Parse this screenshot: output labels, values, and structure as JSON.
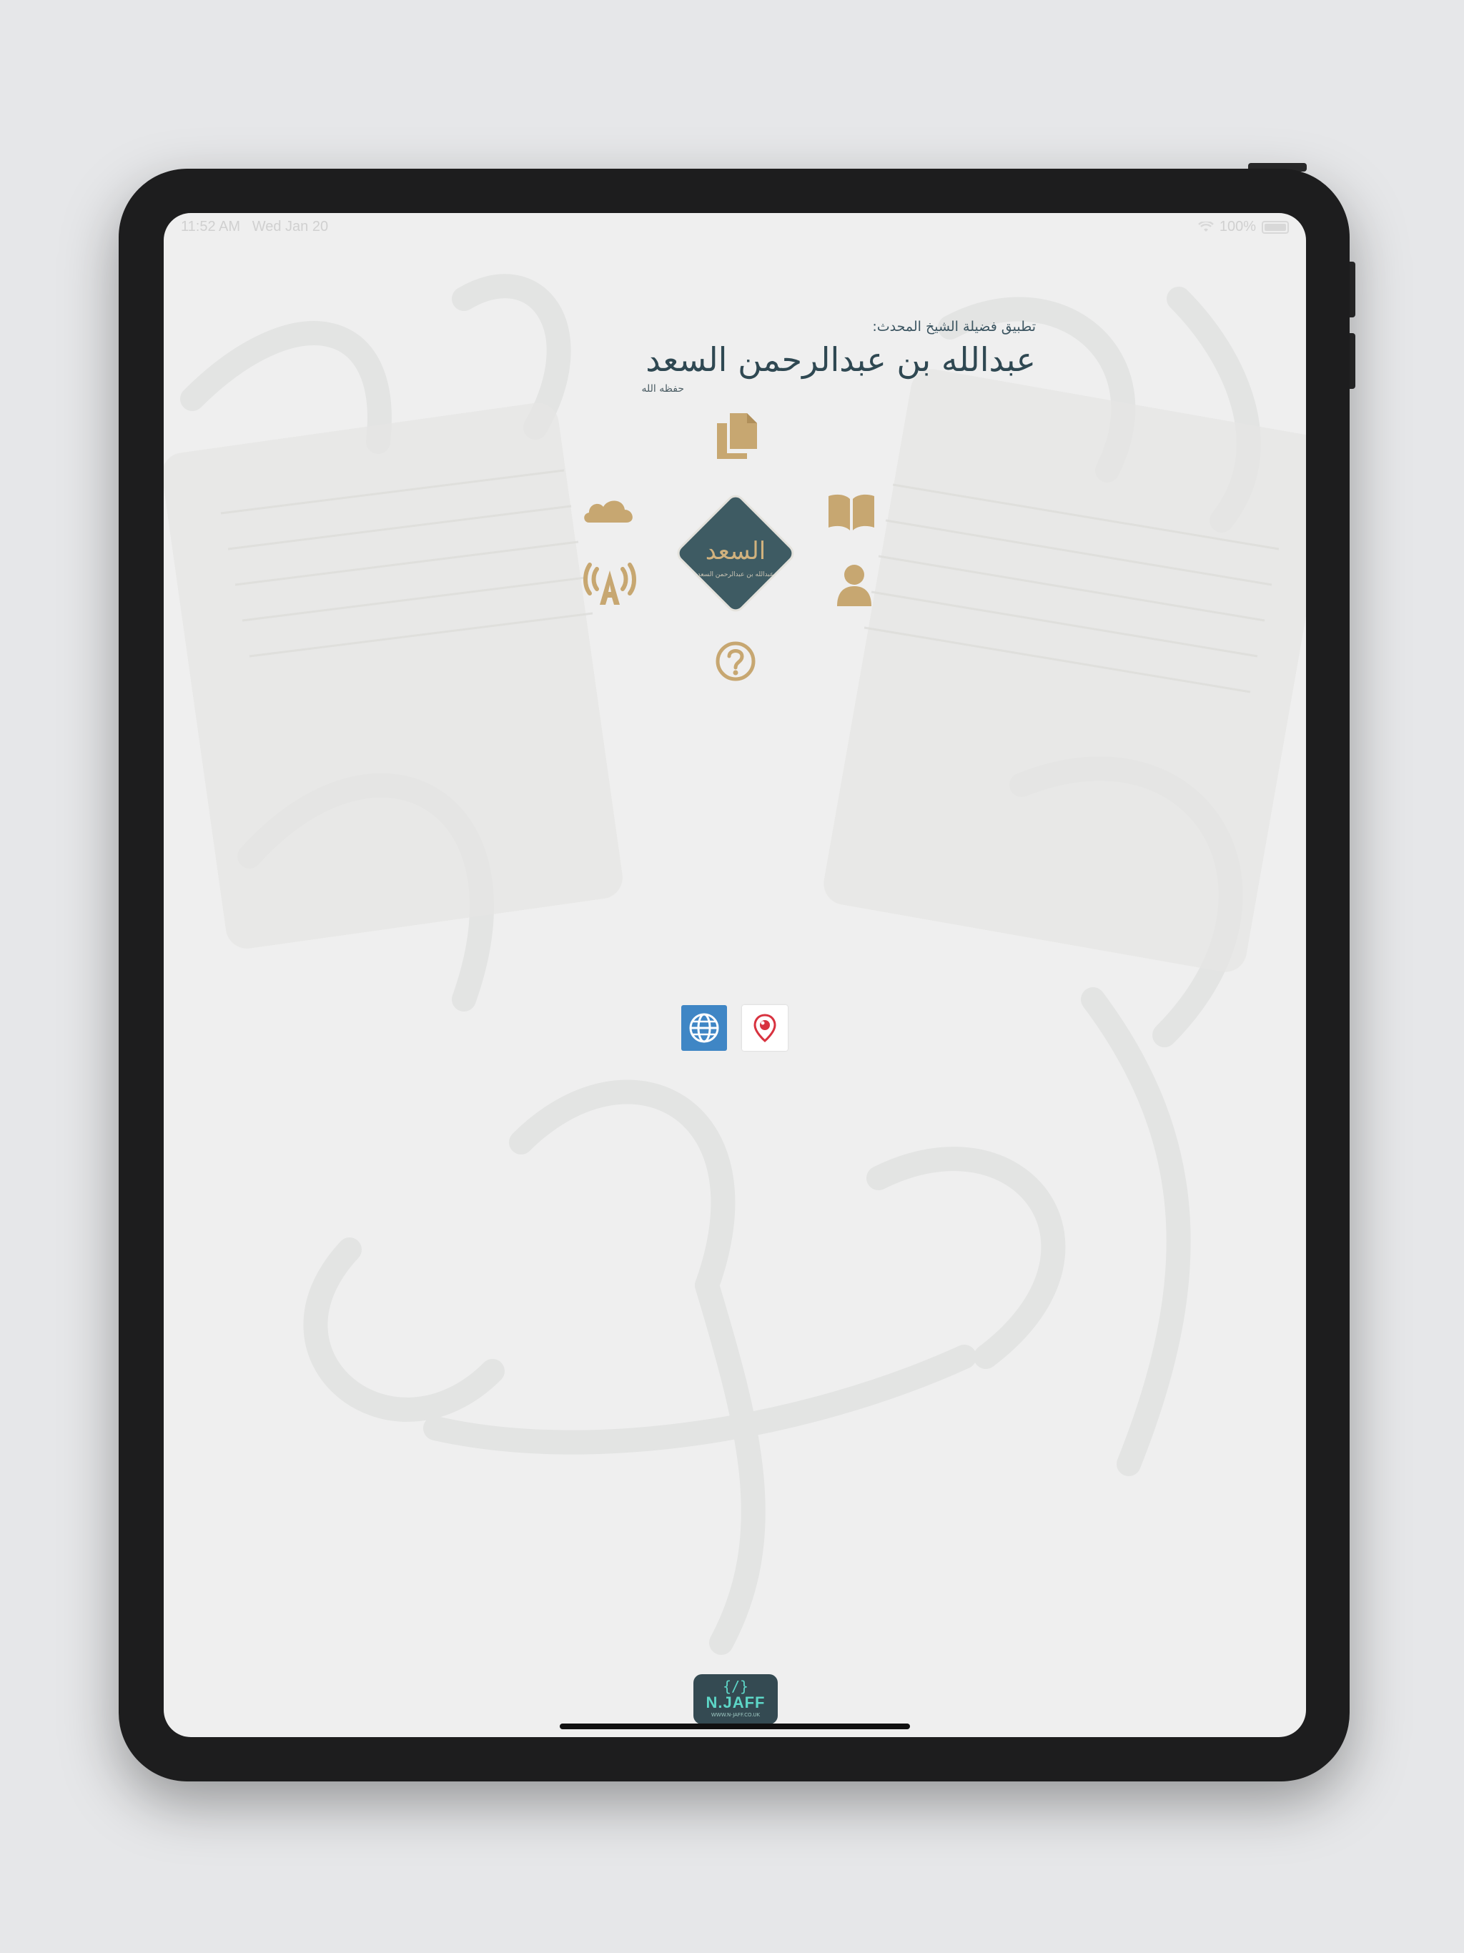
{
  "status_bar": {
    "time": "11:52 AM",
    "date": "Wed Jan 20",
    "battery_text": "100%",
    "wifi_icon": "wifi-icon",
    "battery_icon": "battery-icon"
  },
  "header": {
    "subtitle": "تطبيق فضيلة الشيخ المحدث:",
    "name": "عبدالله بن عبدالرحمن السعد",
    "note": "حفظه الله"
  },
  "menu": {
    "items": [
      {
        "icon": "documents-icon"
      },
      {
        "icon": "cloud-icon"
      },
      {
        "icon": "book-icon"
      },
      {
        "icon": "broadcast-icon"
      },
      {
        "icon": "person-icon"
      },
      {
        "icon": "help-icon"
      }
    ],
    "center_logo": {
      "title": "السعد",
      "subtitle": "عبدالله بن عبدالرحمن السعد"
    }
  },
  "links": [
    {
      "icon": "globe-icon"
    },
    {
      "icon": "periscope-icon"
    }
  ],
  "developer": {
    "code": "{/}",
    "brand": "N.JAFF",
    "url": "WWW.N-JAFF.CO.UK"
  },
  "colors": {
    "accent_gold": "#c7a771",
    "logo_teal": "#3e5b63",
    "web_blue": "#3f86c5",
    "periscope_red": "#d8323f"
  }
}
